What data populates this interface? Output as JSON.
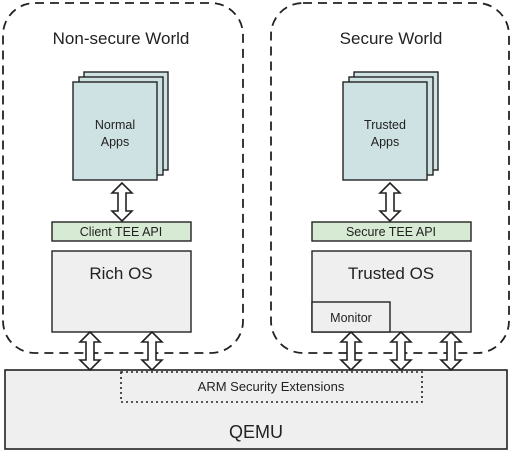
{
  "worlds": {
    "nonsecure_title": "Non-secure World",
    "secure_title": "Secure World"
  },
  "apps": {
    "normal_line1": "Normal",
    "normal_line2": "Apps",
    "trusted_line1": "Trusted",
    "trusted_line2": "Apps"
  },
  "apis": {
    "client": "Client TEE API",
    "secure": "Secure TEE API"
  },
  "os": {
    "rich": "Rich OS",
    "trusted": "Trusted OS",
    "monitor": "Monitor"
  },
  "platform": {
    "extensions": "ARM Security Extensions",
    "qemu": "QEMU"
  },
  "colors": {
    "app_fill": "#cfe2e3",
    "api_fill": "#d7ead3",
    "os_fill": "#efefef",
    "qemu_fill": "#efefef",
    "stroke": "#222222"
  }
}
